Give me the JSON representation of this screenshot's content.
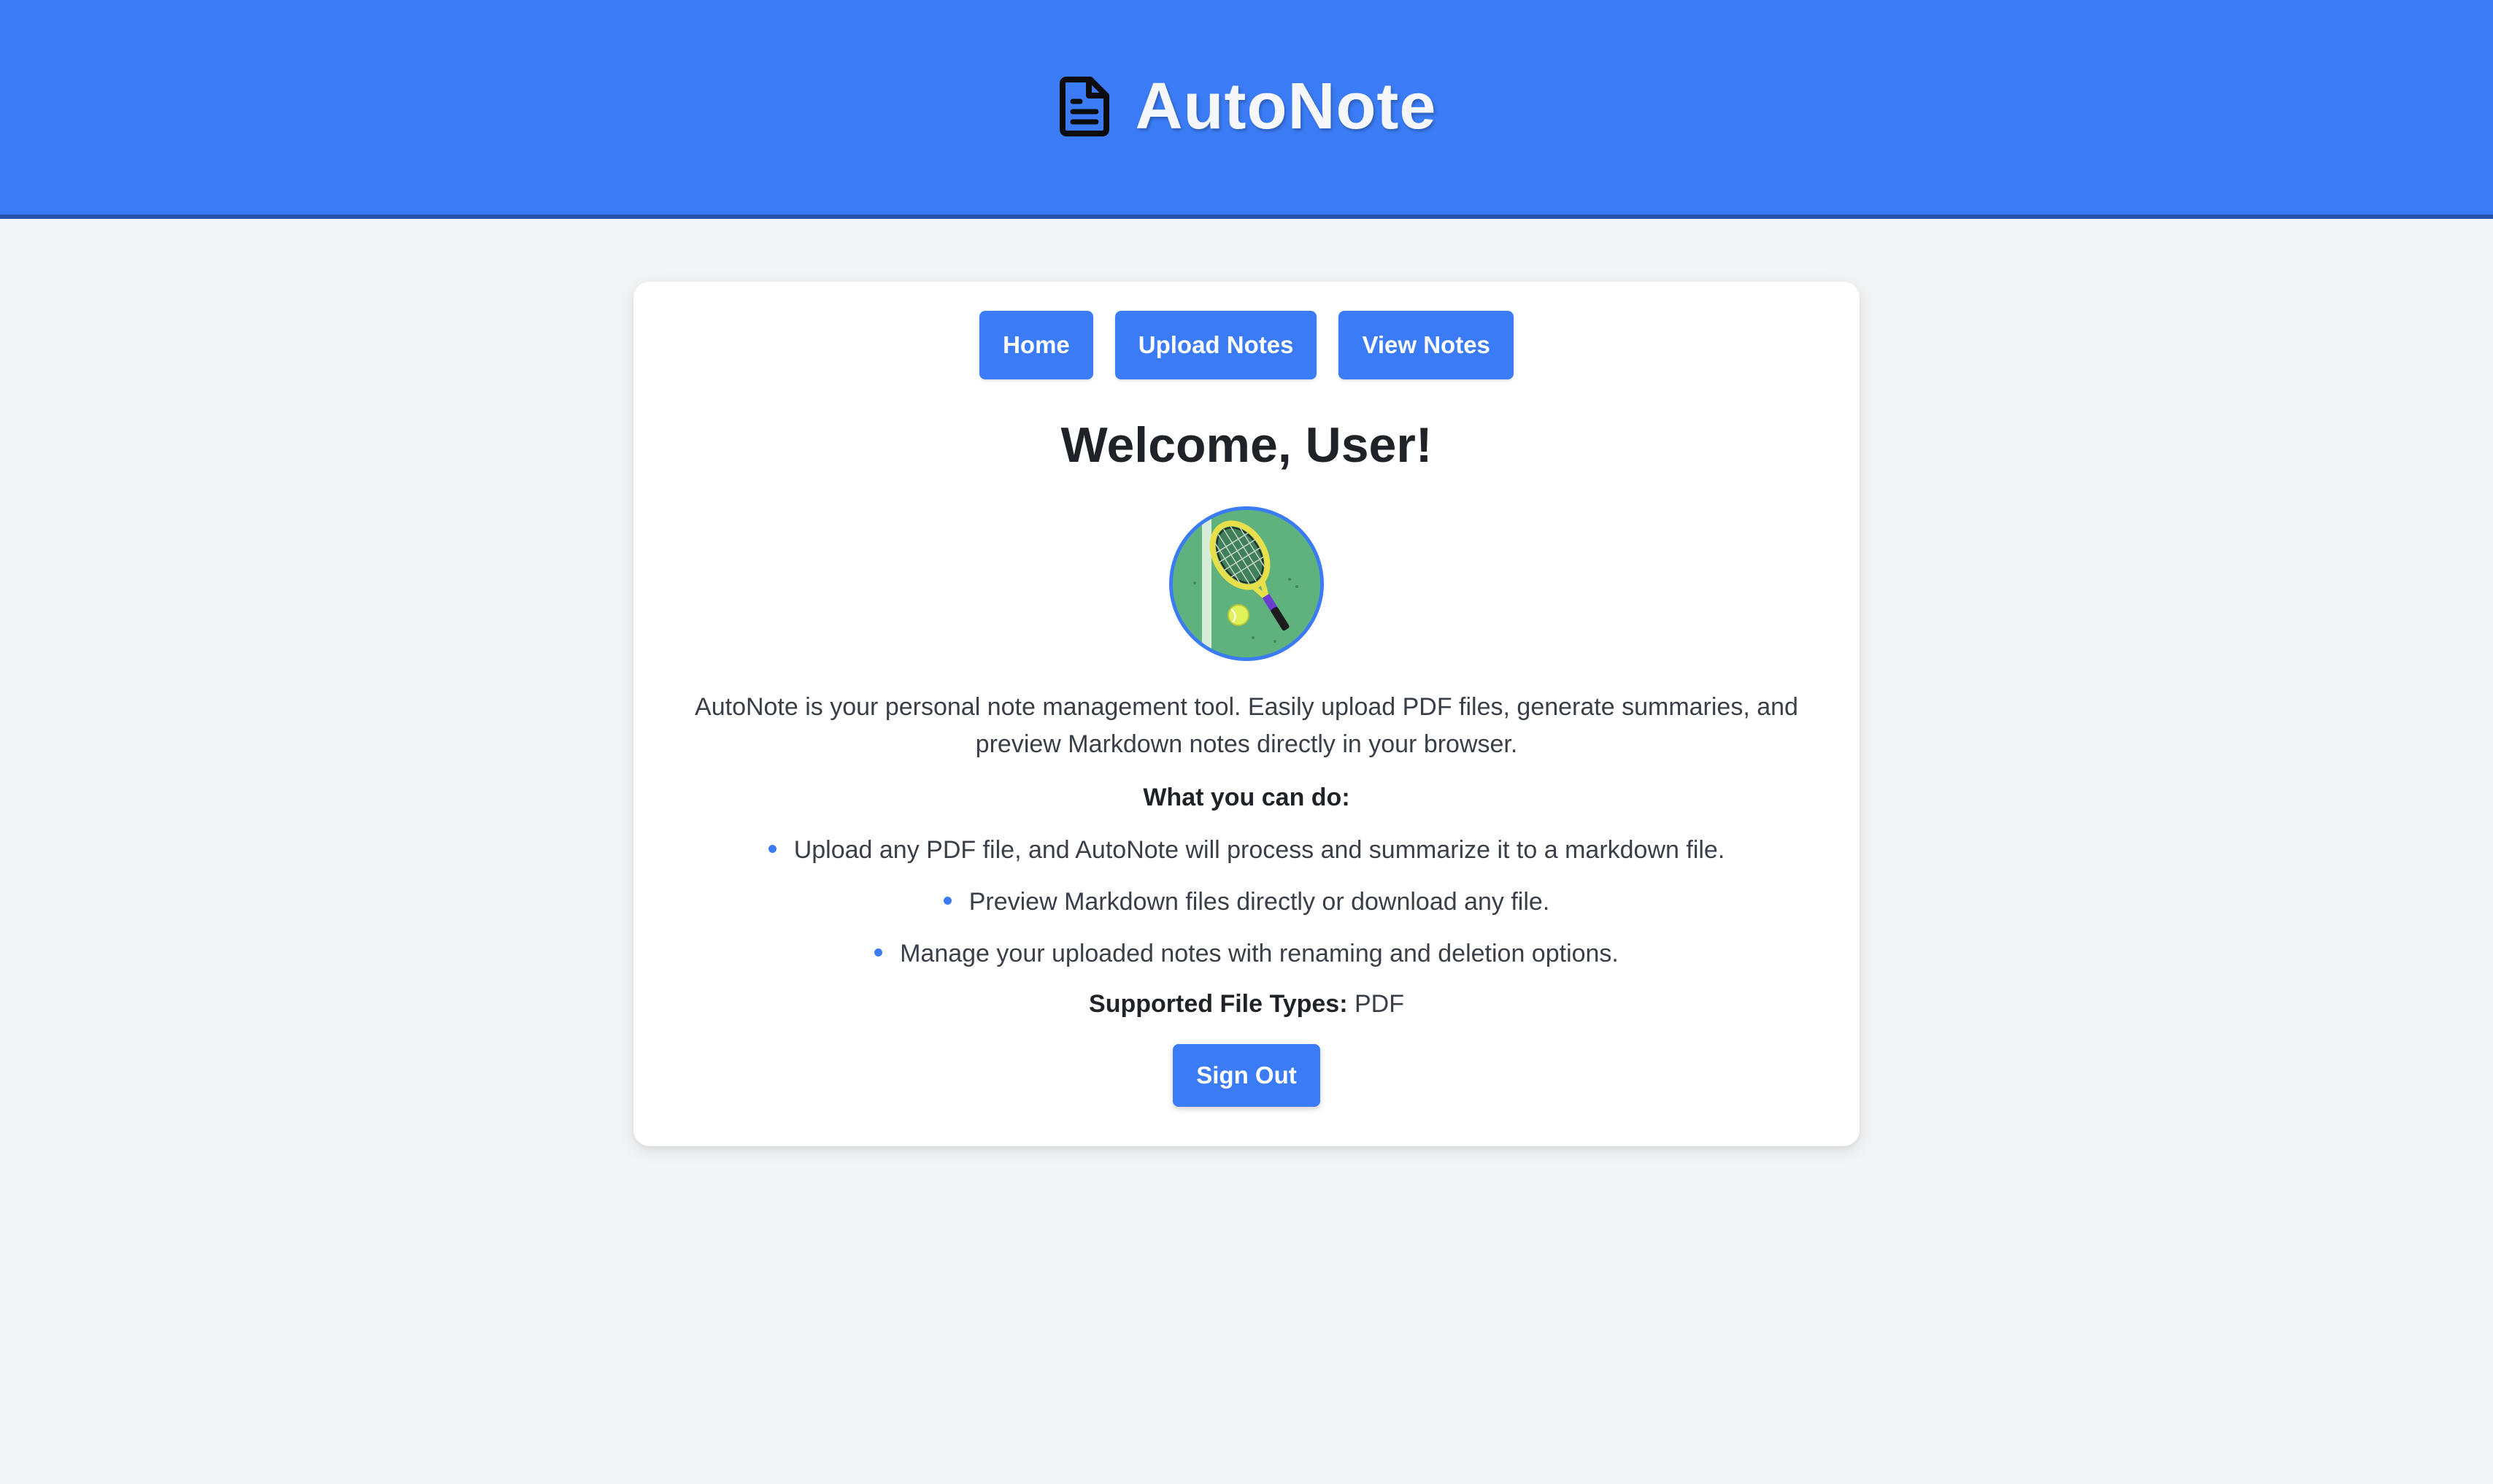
{
  "header": {
    "title": "AutoNote",
    "icon": "document-icon",
    "background_color": "#3b7cf6"
  },
  "nav": {
    "items": [
      {
        "label": "Home"
      },
      {
        "label": "Upload Notes"
      },
      {
        "label": "View Notes"
      }
    ]
  },
  "main": {
    "welcome": "Welcome, User!",
    "avatar_icon": "tennis-racket-icon",
    "description": "AutoNote is your personal note management tool. Easily upload PDF files, generate summaries, and preview Markdown notes directly in your browser.",
    "capabilities_title": "What you can do:",
    "features": [
      "Upload any PDF file, and AutoNote will process and summarize it to a markdown file.",
      "Preview Markdown files directly or download any file.",
      "Manage your uploaded notes with renaming and deletion options."
    ],
    "supported_label": "Supported File Types:",
    "supported_value": "PDF",
    "signout_label": "Sign Out"
  },
  "colors": {
    "accent": "#3b7cf6",
    "page_background": "#f3f4f6",
    "card_background": "#ffffff"
  }
}
